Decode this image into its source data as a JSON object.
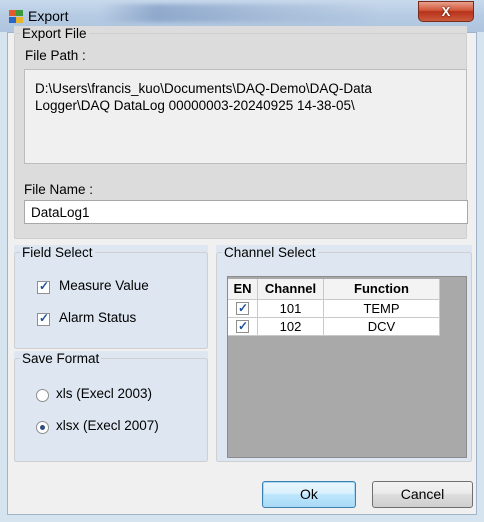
{
  "window": {
    "title": "Export",
    "close_label": "X"
  },
  "export_file": {
    "group_label": "Export File",
    "file_path_label": "File Path :",
    "file_path_line1": "D:\\Users\\francis_kuo\\Documents\\DAQ-Demo\\DAQ-Data",
    "file_path_line2": "Logger\\DAQ DataLog 00000003-20240925 14-38-05\\",
    "file_name_label": "File Name :",
    "file_name_value": "DataLog1"
  },
  "field_select": {
    "group_label": "Field Select",
    "options": [
      {
        "label": "Measure Value",
        "checked": true
      },
      {
        "label": "Alarm Status",
        "checked": true
      }
    ]
  },
  "save_format": {
    "group_label": "Save Format",
    "options": [
      {
        "label": "xls (Execl 2003)",
        "selected": false
      },
      {
        "label": "xlsx (Execl 2007)",
        "selected": true
      }
    ]
  },
  "channel_select": {
    "group_label": "Channel Select",
    "columns": [
      "EN",
      "Channel",
      "Function"
    ],
    "rows": [
      {
        "en": true,
        "channel": "101",
        "function": "TEMP"
      },
      {
        "en": true,
        "channel": "102",
        "function": "DCV"
      }
    ]
  },
  "buttons": {
    "ok": "Ok",
    "cancel": "Cancel"
  },
  "colors": {
    "titlebar": "#b6cbe3",
    "close_button": "#c9462b",
    "group_background": "#dee6f1",
    "export_group_background": "#dcdcdc"
  }
}
